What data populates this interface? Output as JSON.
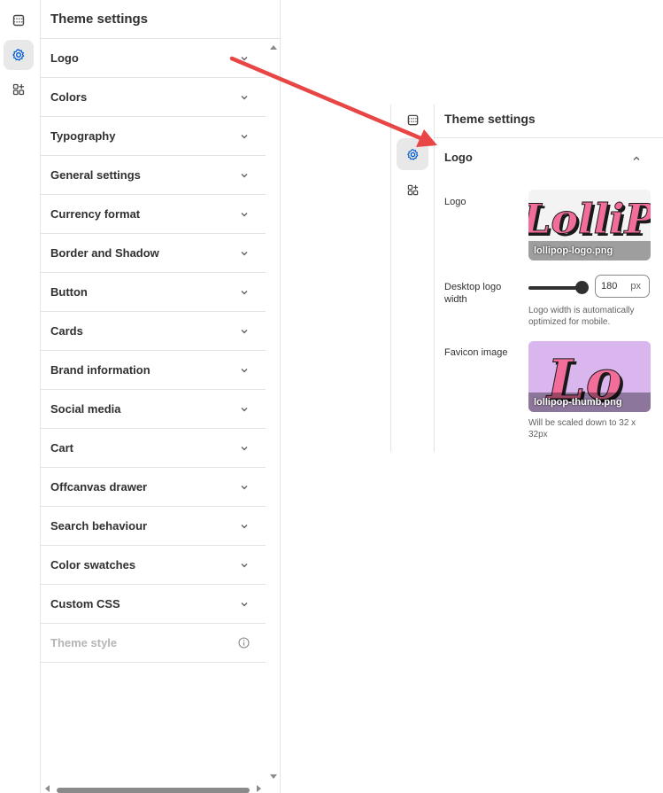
{
  "left_panel": {
    "title": "Theme settings",
    "items": [
      {
        "label": "Logo",
        "icon": "chevron-down-icon"
      },
      {
        "label": "Colors",
        "icon": "chevron-down-icon"
      },
      {
        "label": "Typography",
        "icon": "chevron-down-icon"
      },
      {
        "label": "General settings",
        "icon": "chevron-down-icon"
      },
      {
        "label": "Currency format",
        "icon": "chevron-down-icon"
      },
      {
        "label": "Border and Shadow",
        "icon": "chevron-down-icon"
      },
      {
        "label": "Button",
        "icon": "chevron-down-icon"
      },
      {
        "label": "Cards",
        "icon": "chevron-down-icon"
      },
      {
        "label": "Brand information",
        "icon": "chevron-down-icon"
      },
      {
        "label": "Social media",
        "icon": "chevron-down-icon"
      },
      {
        "label": "Cart",
        "icon": "chevron-down-icon"
      },
      {
        "label": "Offcanvas drawer",
        "icon": "chevron-down-icon"
      },
      {
        "label": "Search behaviour",
        "icon": "chevron-down-icon"
      },
      {
        "label": "Color swatches",
        "icon": "chevron-down-icon"
      },
      {
        "label": "Custom CSS",
        "icon": "chevron-down-icon"
      },
      {
        "label": "Theme style",
        "icon": "info-icon",
        "disabled": true
      }
    ]
  },
  "rail": {
    "icons": [
      "sections-icon",
      "gear-icon",
      "apps-add-icon"
    ],
    "active": "gear-icon"
  },
  "detail": {
    "title": "Theme settings",
    "section": "Logo",
    "logo": {
      "label": "Logo",
      "filename": "lollipop-logo.png",
      "image_text": "LolliPop"
    },
    "logo_width": {
      "label": "Desktop logo width",
      "value": "180",
      "unit": "px",
      "slider_fraction": 1.0,
      "help": "Logo width is automatically optimized for mobile."
    },
    "favicon": {
      "label": "Favicon image",
      "filename": "lollipop-thumb.png",
      "image_text": "Lo",
      "help": "Will be scaled down to 32 x 32px"
    }
  },
  "colors": {
    "accent": "#005bd3",
    "annotation_arrow": "#e84545",
    "logo_pink": "#f26d9a",
    "favicon_bg": "#d9b6ee"
  }
}
